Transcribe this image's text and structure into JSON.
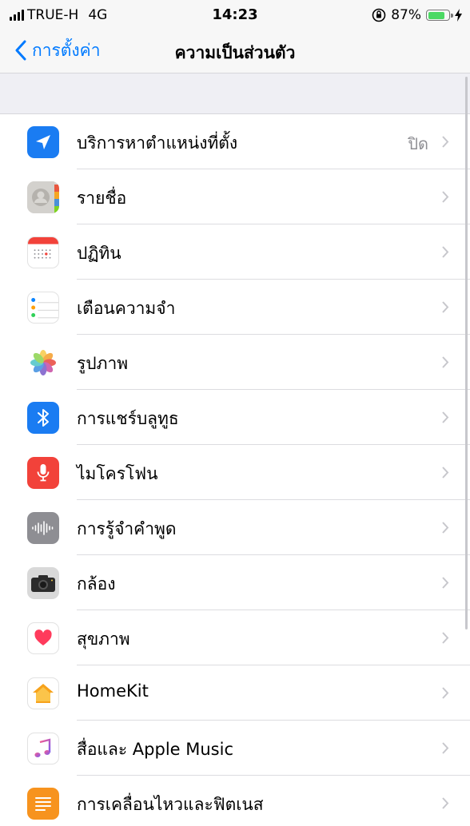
{
  "status_bar": {
    "carrier": "TRUE-H",
    "network": "4G",
    "time": "14:23",
    "battery_percent_text": "87%",
    "battery_level": 0.87
  },
  "nav": {
    "back_label": "การตั้งค่า",
    "title": "ความเป็นส่วนตัว"
  },
  "rows": [
    {
      "label": "บริการหาตำแหน่งที่ตั้ง",
      "value": "ปิด",
      "icon": "location-arrow-icon"
    },
    {
      "label": "รายชื่อ",
      "value": "",
      "icon": "contacts-icon"
    },
    {
      "label": "ปฏิทิน",
      "value": "",
      "icon": "calendar-icon"
    },
    {
      "label": "เตือนความจำ",
      "value": "",
      "icon": "reminders-icon"
    },
    {
      "label": "รูปภาพ",
      "value": "",
      "icon": "photos-icon"
    },
    {
      "label": "การแชร์บลูทูธ",
      "value": "",
      "icon": "bluetooth-icon"
    },
    {
      "label": "ไมโครโฟน",
      "value": "",
      "icon": "microphone-icon"
    },
    {
      "label": "การรู้จำคำพูด",
      "value": "",
      "icon": "speech-recognition-icon"
    },
    {
      "label": "กล้อง",
      "value": "",
      "icon": "camera-icon"
    },
    {
      "label": "สุขภาพ",
      "value": "",
      "icon": "health-heart-icon"
    },
    {
      "label": "HomeKit",
      "value": "",
      "icon": "homekit-icon"
    },
    {
      "label": "สื่อและ Apple Music",
      "value": "",
      "icon": "music-note-icon"
    },
    {
      "label": "การเคลื่อนไหวและฟิตเนส",
      "value": "",
      "icon": "motion-fitness-icon"
    }
  ],
  "colors": {
    "accent": "#007aff",
    "location": "#1a7cf2",
    "bluetooth": "#1a7cf2",
    "microphone": "#f2423a",
    "speech": "#8e8e93",
    "camera": "#d9d9d9",
    "motion": "#f7931e",
    "battery": "#4cd964"
  }
}
